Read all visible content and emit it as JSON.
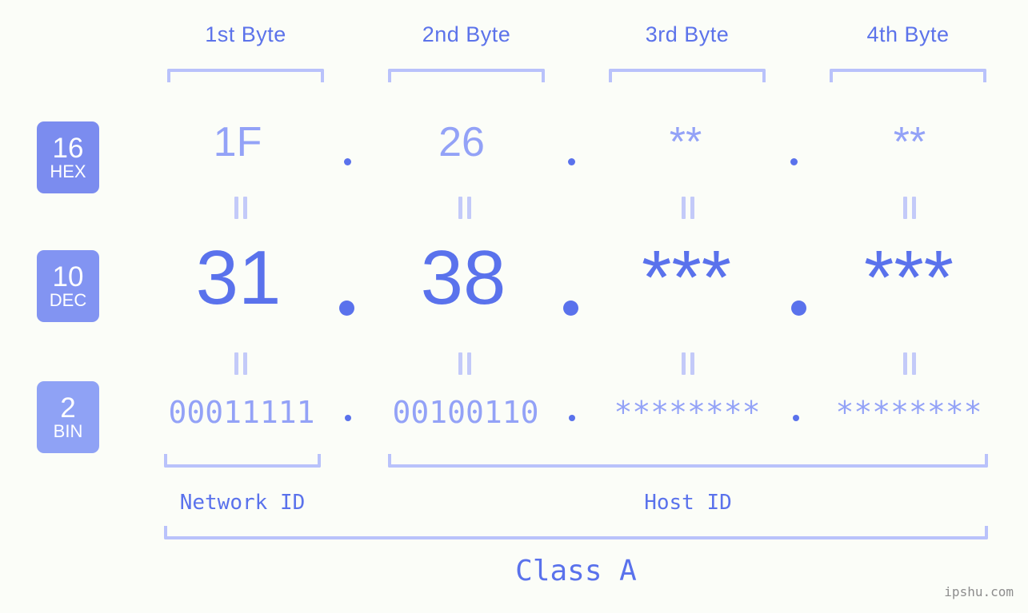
{
  "meta": {
    "background": "#fbfdf8",
    "accent_strong": "#5a72ec",
    "accent_light": "#93a2f7",
    "bracket_color": "#b9c2fb",
    "connector_color": "#c3caf9"
  },
  "byte_headers": [
    {
      "label": "1st Byte"
    },
    {
      "label": "2nd Byte"
    },
    {
      "label": "3rd Byte"
    },
    {
      "label": "4th Byte"
    }
  ],
  "rows": [
    {
      "key": "hex",
      "radix": "16",
      "radix_name": "HEX",
      "badge_color": "#7b8cef",
      "values": [
        "1F",
        "26",
        "**",
        "**"
      ],
      "separator": "."
    },
    {
      "key": "dec",
      "radix": "10",
      "radix_name": "DEC",
      "badge_color": "#8294f2",
      "values": [
        "31",
        "38",
        "***",
        "***"
      ],
      "separator": "."
    },
    {
      "key": "bin",
      "radix": "2",
      "radix_name": "BIN",
      "badge_color": "#8fa2f5",
      "values": [
        "00011111",
        "00100110",
        "********",
        "********"
      ],
      "separator": "."
    }
  ],
  "connector_symbol": "=",
  "regions": [
    {
      "id": "network",
      "label": "Network ID"
    },
    {
      "id": "host",
      "label": "Host ID"
    }
  ],
  "class_label": "Class A",
  "watermark": "ipshu.com"
}
